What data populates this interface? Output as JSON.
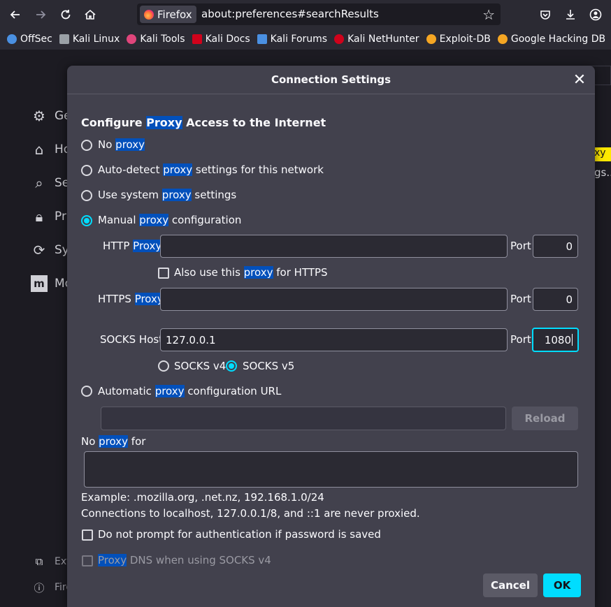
{
  "browser": {
    "identity_label": "Firefox",
    "url": "about:preferences#searchResults"
  },
  "bookmarks": [
    {
      "label": "OffSec",
      "color": "#4a90e2"
    },
    {
      "label": "Kali Linux",
      "color": "#9aa0a6"
    },
    {
      "label": "Kali Tools",
      "color": "#e0457b"
    },
    {
      "label": "Kali Docs",
      "color": "#d0021b"
    },
    {
      "label": "Kali Forums",
      "color": "#4a90e2"
    },
    {
      "label": "Kali NetHunter",
      "color": "#d0021b"
    },
    {
      "label": "Exploit-DB",
      "color": "#f5a623"
    },
    {
      "label": "Google Hacking DB",
      "color": "#f5a623"
    }
  ],
  "background": {
    "sidebar": [
      {
        "label": "Ge",
        "icon": "gear-icon"
      },
      {
        "label": "Ho",
        "icon": "home-icon"
      },
      {
        "label": "Se",
        "icon": "search-icon"
      },
      {
        "label": "Pri",
        "icon": "lock-icon"
      },
      {
        "label": "Syı",
        "icon": "sync-icon"
      },
      {
        "label": "Mo",
        "icon": "mozilla-icon"
      }
    ],
    "footer": [
      {
        "label": "Ext",
        "icon": "puzzle-icon"
      },
      {
        "label": "Fire",
        "icon": "help-icon"
      }
    ],
    "highlight_text": "xy",
    "more_text": "gs..."
  },
  "dialog": {
    "title": "Connection Settings",
    "heading": {
      "pre": "Configure ",
      "hl": "Proxy",
      "post": " Access to the Internet"
    },
    "options": {
      "no_proxy": {
        "pre": "No ",
        "hl": "proxy",
        "post": ""
      },
      "auto_detect": {
        "pre": "Auto-detect ",
        "hl": "proxy",
        "post": " settings for this network"
      },
      "system": {
        "pre": "Use system ",
        "hl": "proxy",
        "post": " settings"
      },
      "manual": {
        "pre": "Manual ",
        "hl": "proxy",
        "post": " configuration"
      },
      "auto_url": {
        "pre": "Automatic ",
        "hl": "proxy",
        "post": " configuration URL"
      }
    },
    "selected_option": "manual",
    "http": {
      "label_pre": "HTTP ",
      "label_hl": "Proxy",
      "value": "",
      "port_label": "Port",
      "port": "0"
    },
    "also_https": {
      "pre": "Also use this ",
      "hl": "proxy",
      "post": " for HTTPS",
      "checked": false
    },
    "https": {
      "label_pre": "HTTPS ",
      "label_hl": "Proxy",
      "value": "",
      "port_label": "Port",
      "port": "0"
    },
    "socks": {
      "label": "SOCKS Host",
      "value": "127.0.0.1",
      "port_label": "Port",
      "port": "1080",
      "v4_label": "SOCKS v4",
      "v5_label": "SOCKS v5",
      "version": "v5"
    },
    "auto_url_value": "",
    "reload_label": "Reload",
    "no_proxy_for": {
      "pre": "No ",
      "hl": "proxy",
      "post": " for",
      "value": ""
    },
    "example_text": "Example: .mozilla.org, .net.nz, 192.168.1.0/24",
    "localhost_note": "Connections to localhost, 127.0.0.1/8, and ::1 are never proxied.",
    "no_prompt_auth": {
      "label": "Do not prompt for authentication if password is saved",
      "checked": false
    },
    "proxy_dns": {
      "hl": "Proxy",
      "post": " DNS when using SOCKS v4",
      "checked": false
    },
    "cancel_label": "Cancel",
    "ok_label": "OK"
  },
  "colors": {
    "accent": "#00ddff",
    "highlight": "#0250bb",
    "dialog_bg": "#42414d",
    "field_bg": "#2b2a33",
    "ok_bg": "#00ddff"
  }
}
